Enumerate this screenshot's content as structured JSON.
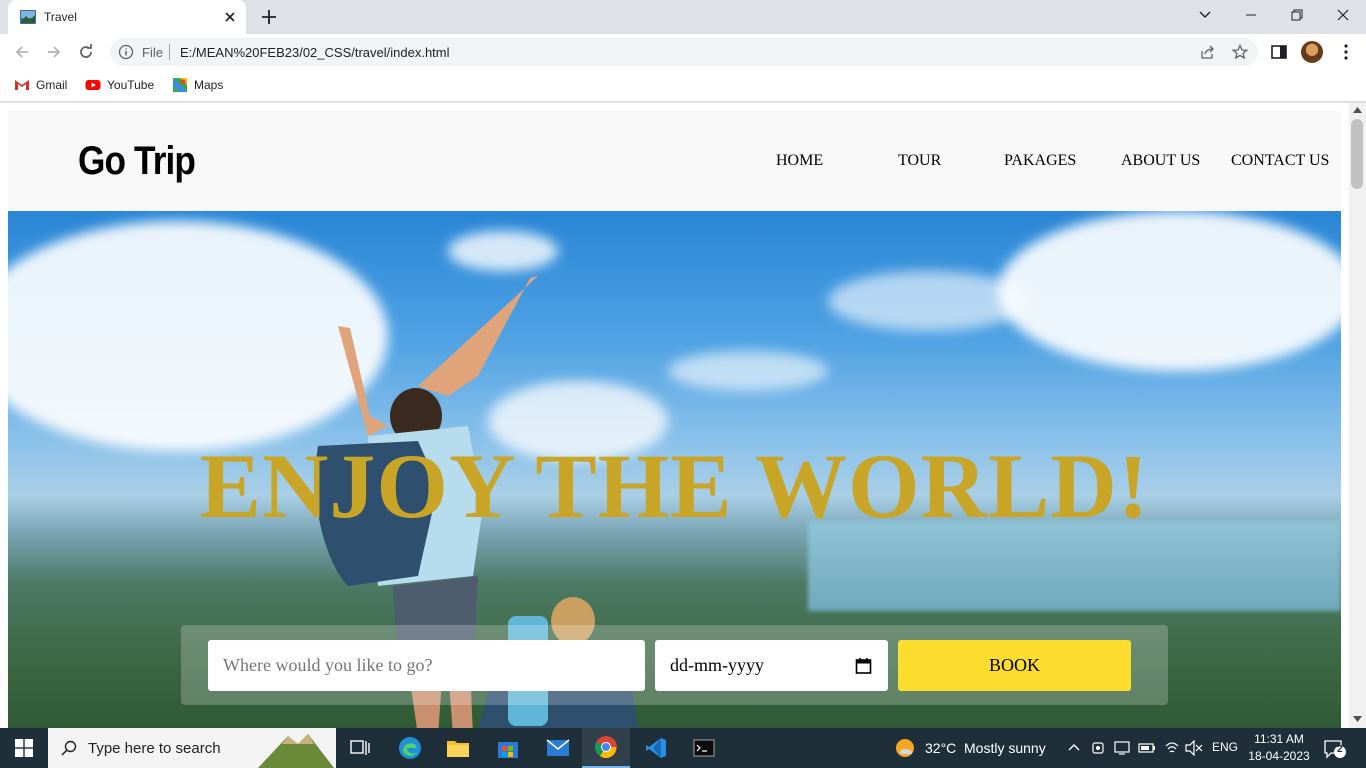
{
  "browser": {
    "tab_title": "Travel",
    "url_scheme": "File",
    "url": "E:/MEAN%20FEB23/02_CSS/travel/index.html",
    "bookmarks": [
      {
        "label": "Gmail",
        "icon": "gmail-icon"
      },
      {
        "label": "YouTube",
        "icon": "youtube-icon"
      },
      {
        "label": "Maps",
        "icon": "maps-icon"
      }
    ]
  },
  "site": {
    "logo": "Go Trip",
    "nav": [
      "HOME",
      "TOUR",
      "PAKAGES",
      "ABOUT US",
      "CONTACT US"
    ],
    "hero_title": "ENJOY THE WORLD!",
    "booking": {
      "destination_placeholder": "Where would you like to go?",
      "date_placeholder": "dd-mm-yyyy",
      "book_label": "BOOK"
    },
    "colors": {
      "hero_title": "#c8a526",
      "book_button": "#fbdc2f",
      "header_bg": "#f8f8f8"
    }
  },
  "taskbar": {
    "search_placeholder": "Type here to search",
    "weather_temp": "32°C",
    "weather_desc": "Mostly sunny",
    "language": "ENG",
    "time": "11:31 AM",
    "date": "18-04-2023",
    "notification_count": "2"
  }
}
